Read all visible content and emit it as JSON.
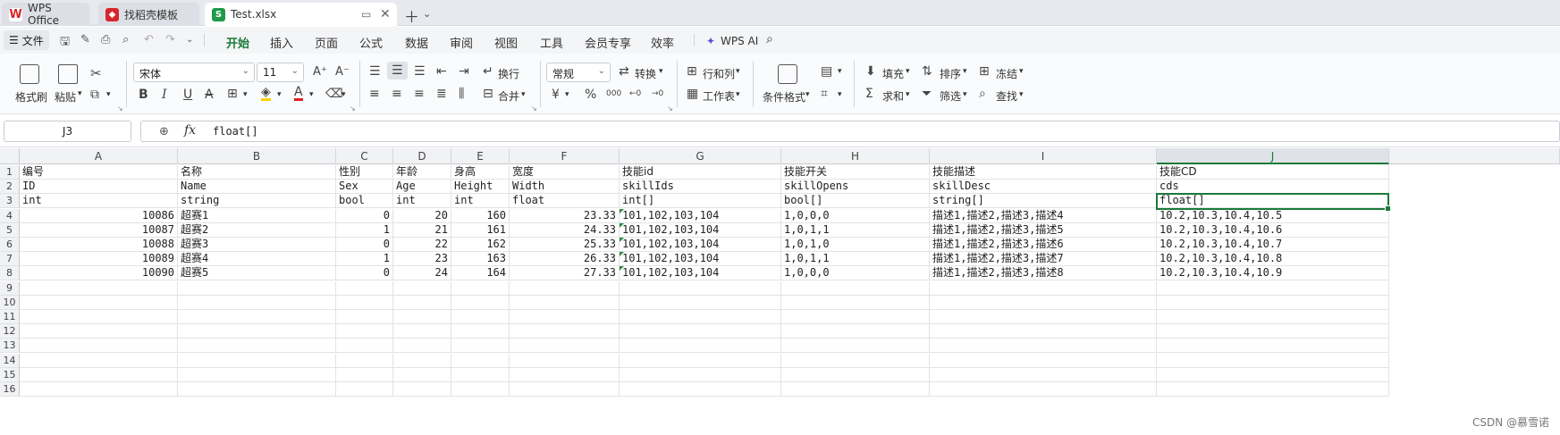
{
  "tabs": [
    {
      "label": "WPS Office",
      "icon": "wps-logo-icon",
      "color": "#d7262b"
    },
    {
      "label": "找稻壳模板",
      "icon": "docer-logo-icon",
      "color": "#d7262b"
    },
    {
      "label": "Test.xlsx",
      "icon": "spreadsheet-logo-icon",
      "color": "#1e9a4a",
      "logo_letter": "S"
    }
  ],
  "menu": {
    "file_label": "文件",
    "ribbon_tabs": [
      "开始",
      "插入",
      "页面",
      "公式",
      "数据",
      "审阅",
      "视图",
      "工具",
      "会员专享",
      "效率"
    ],
    "active_tab": "开始",
    "ai_label": "WPS AI"
  },
  "ribbon": {
    "format_painter": "格式刷",
    "paste": "粘贴",
    "font_name": "宋体",
    "font_size": "11",
    "wrap": "换行",
    "merge": "合并",
    "number_format": "常规",
    "convert": "转换",
    "rows_cols": "行和列",
    "worksheet": "工作表",
    "cond_format": "条件格式",
    "fill": "填充",
    "sort": "排序",
    "freeze": "冻结",
    "sum": "求和",
    "filter": "筛选",
    "find": "查找",
    "currency_symbol": "¥",
    "percent_symbol": "%",
    "thousands_symbol": "000"
  },
  "formula_bar": {
    "name_box": "J3",
    "fx_label": "fx",
    "value": "float[]"
  },
  "sheet": {
    "columns": [
      "A",
      "B",
      "C",
      "D",
      "E",
      "F",
      "G",
      "H",
      "I",
      "J"
    ],
    "selected_column": "J",
    "row_numbers": [
      "1",
      "2",
      "3",
      "4",
      "5",
      "6",
      "7",
      "8",
      "9",
      "10",
      "11",
      "12",
      "13",
      "14",
      "15",
      "16"
    ],
    "header_rows": [
      [
        "编号",
        "名称",
        "性别",
        "年龄",
        "身高",
        "宽度",
        "技能id",
        "技能开关",
        "技能描述",
        "技能CD"
      ],
      [
        "ID",
        "Name",
        "Sex",
        "Age",
        "Height",
        "Width",
        "skillIds",
        "skillOpens",
        "skillDesc",
        "cds"
      ],
      [
        "int",
        "string",
        "bool",
        "int",
        "int",
        "float",
        "int[]",
        "bool[]",
        "string[]",
        "float[]"
      ]
    ],
    "data_rows": [
      [
        "10086",
        "超赛1",
        "0",
        "20",
        "160",
        "23.33",
        "101,102,103,104",
        "1,0,0,0",
        "描述1,描述2,描述3,描述4",
        "10.2,10.3,10.4,10.5"
      ],
      [
        "10087",
        "超赛2",
        "1",
        "21",
        "161",
        "24.33",
        "101,102,103,104",
        "1,0,1,1",
        "描述1,描述2,描述3,描述5",
        "10.2,10.3,10.4,10.6"
      ],
      [
        "10088",
        "超赛3",
        "0",
        "22",
        "162",
        "25.33",
        "101,102,103,104",
        "1,0,1,0",
        "描述1,描述2,描述3,描述6",
        "10.2,10.3,10.4,10.7"
      ],
      [
        "10089",
        "超赛4",
        "1",
        "23",
        "163",
        "26.33",
        "101,102,103,104",
        "1,0,1,1",
        "描述1,描述2,描述3,描述7",
        "10.2,10.3,10.4,10.8"
      ],
      [
        "10090",
        "超赛5",
        "0",
        "24",
        "164",
        "27.33",
        "101,102,103,104",
        "1,0,0,0",
        "描述1,描述2,描述3,描述8",
        "10.2,10.3,10.4,10.9"
      ]
    ],
    "selected_cell": "J3"
  },
  "watermark": "CSDN @慕雪诺",
  "colors": {
    "accent": "#1c7a39",
    "tab_bar": "#e7e9ee"
  }
}
